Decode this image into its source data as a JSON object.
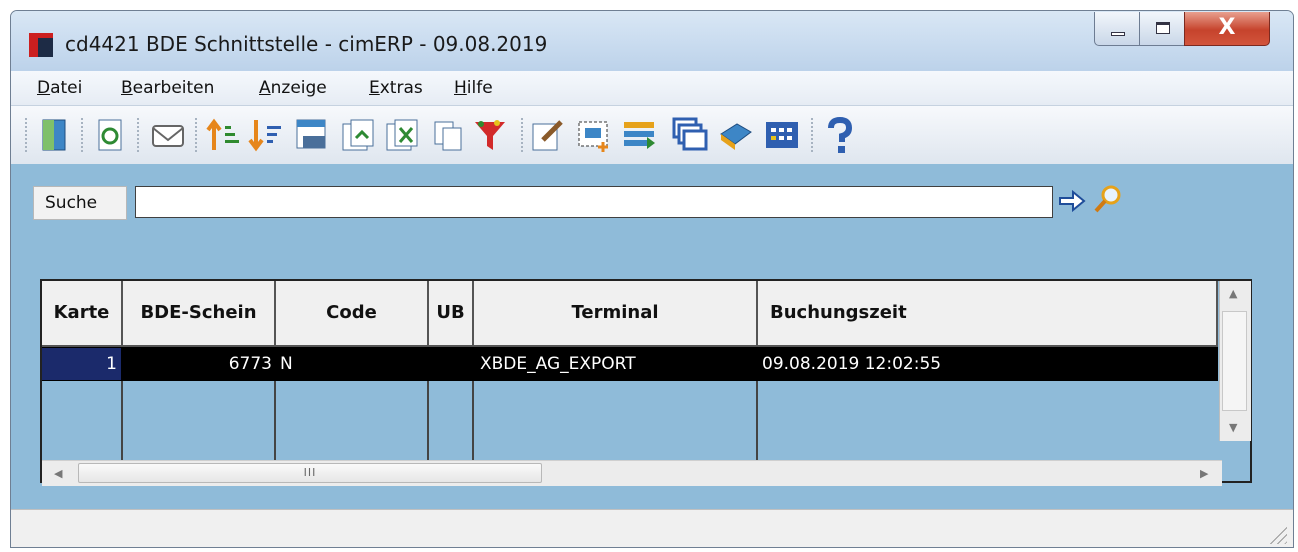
{
  "window": {
    "title": "cd4421 BDE Schnittstelle - cimERP - 09.08.2019",
    "close_label": "X"
  },
  "menu": [
    {
      "label": "Datei"
    },
    {
      "label": "Bearbeiten"
    },
    {
      "label": "Anzeige"
    },
    {
      "label": "Extras"
    },
    {
      "label": "Hilfe"
    }
  ],
  "toolbar_icons": [
    "exit-door-icon",
    "refresh-icon",
    "mail-icon",
    "sort-ascending-icon",
    "sort-descending-icon",
    "calendar-123-icon",
    "export-icon",
    "excel-export-icon",
    "copy-icon",
    "filter-funnel-icon",
    "edit-icon",
    "select-area-icon",
    "list-add-icon",
    "windows-icon",
    "book-pen-icon",
    "grid-icon",
    "help-question-icon"
  ],
  "search": {
    "label": "Suche",
    "value": ""
  },
  "table": {
    "headers": [
      "Karte",
      "BDE-Schein",
      "Code",
      "UB",
      "Terminal",
      "Buchungszeit"
    ],
    "rows": [
      {
        "karte": "1",
        "bde_schein": "6773",
        "code": "N",
        "ub": "",
        "terminal": "XBDE_AG_EXPORT",
        "buchungszeit": "09.08.2019 12:02:55"
      }
    ]
  },
  "scroll": {
    "h_thumb_grip": "III"
  },
  "colors": {
    "workspace": "#8fbbd9",
    "selected_row": "#000000",
    "row_indicator": "#1b2a6b"
  }
}
